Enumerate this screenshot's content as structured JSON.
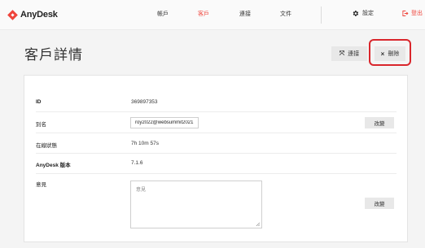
{
  "app": {
    "logo_text": "AnyDesk",
    "accent": "#ef443b"
  },
  "nav": {
    "items": [
      {
        "label": "帳戶"
      },
      {
        "label": "客戶"
      },
      {
        "label": "連接"
      },
      {
        "label": "文件"
      }
    ],
    "settings_label": "設定",
    "logout_label": "登出"
  },
  "page": {
    "title": "客戶詳情",
    "connect_label": "連接",
    "delete_label": "刪除"
  },
  "details": {
    "id_label": "ID",
    "id_value": "369897353",
    "alias_label": "別名",
    "alias_value": "roy2022@websummit2021",
    "alias_change": "改變",
    "online_label": "在線狀態",
    "online_value": "7h 10m 57s",
    "version_label": "AnyDesk 版本",
    "version_value": "7.1.6",
    "comment_label": "意見",
    "comment_placeholder": "意見",
    "comment_change": "改變"
  }
}
